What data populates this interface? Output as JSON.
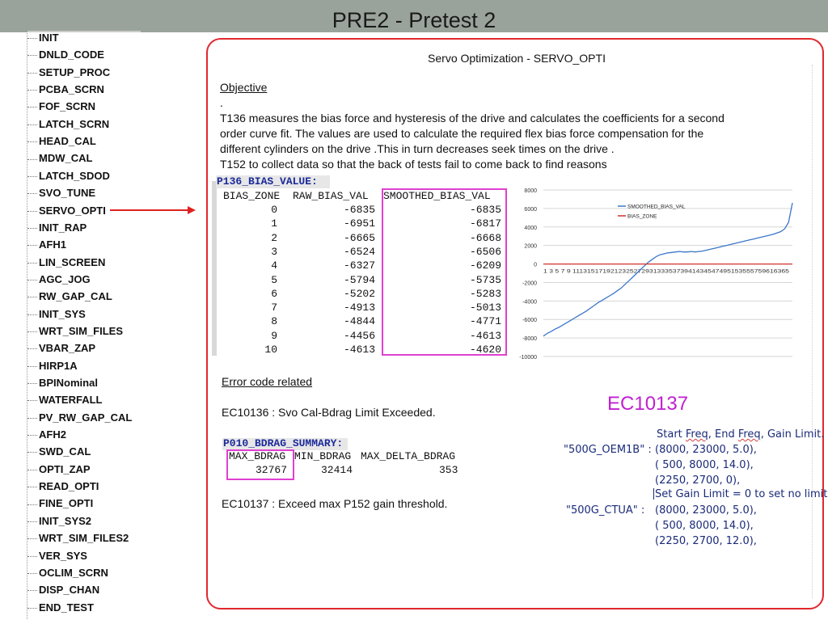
{
  "slide_title": "PRE2 - Pretest 2",
  "sidebar": {
    "items": [
      "INIT",
      "DNLD_CODE",
      "SETUP_PROC",
      "PCBA_SCRN",
      "FOF_SCRN",
      "LATCH_SCRN",
      "HEAD_CAL",
      "MDW_CAL",
      "LATCH_SDOD",
      "SVO_TUNE",
      "SERVO_OPTI",
      "INIT_RAP",
      "AFH1",
      "LIN_SCREEN",
      "AGC_JOG",
      "RW_GAP_CAL",
      "INIT_SYS",
      "WRT_SIM_FILES",
      "VBAR_ZAP",
      "HIRP1A",
      "BPINominal",
      "WATERFALL",
      "PV_RW_GAP_CAL",
      "AFH2",
      "SWD_CAL",
      "OPTI_ZAP",
      "READ_OPTI",
      "FINE_OPTI",
      "INIT_SYS2",
      "WRT_SIM_FILES2",
      "VER_SYS",
      "OCLIM_SCRN",
      "DISP_CHAN",
      "END_TEST"
    ],
    "highlighted": "SERVO_OPTI"
  },
  "panel": {
    "heading": "Servo Optimization - SERVO_OPTI",
    "objective_label": "Objective",
    "objective_dot": ".",
    "objective_lines": [
      "T136 measures the bias force and hysteresis of the drive and calculates the coefficients for a second",
      "order curve fit. The values are used to calculate the required flex bias force compensation for the",
      "different cylinders on the drive .This in turn decreases seek times on the drive .",
      "T152 to collect data so that the back of tests fail to come back to find reasons"
    ],
    "bias_table": {
      "title": "P136_BIAS_VALUE:",
      "headers": [
        "BIAS_ZONE",
        "RAW_BIAS_VAL",
        "SMOOTHED_BIAS_VAL"
      ],
      "rows": [
        [
          "0",
          "-6835",
          "-6835"
        ],
        [
          "1",
          "-6951",
          "-6817"
        ],
        [
          "2",
          "-6665",
          "-6668"
        ],
        [
          "3",
          "-6524",
          "-6506"
        ],
        [
          "4",
          "-6327",
          "-6209"
        ],
        [
          "5",
          "-5794",
          "-5735"
        ],
        [
          "6",
          "-5202",
          "-5283"
        ],
        [
          "7",
          "-4913",
          "-5013"
        ],
        [
          "8",
          "-4844",
          "-4771"
        ],
        [
          "9",
          "-4456",
          "-4613"
        ],
        [
          "10",
          "-4613",
          "-4620"
        ]
      ]
    },
    "error_label": "Error code related",
    "ec1": "EC10136 : Svo Cal-Bdrag Limit Exceeded.",
    "bdrag": {
      "title": "P010_BDRAG_SUMMARY:",
      "headers": [
        "MAX_BDRAG",
        "MIN_BDRAG",
        "MAX_DELTA_BDRAG"
      ],
      "values": [
        "32767",
        "32414",
        "353"
      ]
    },
    "ec2": "EC10137 : Exceed max P152 gain threshold.",
    "ec_big": "EC10137",
    "gain_note": {
      "header": "Start Freq, End Freq, Gain Limit.",
      "header_freq1": "Freq",
      "header_freq2": "Freq",
      "oem_label": "\"500G_OEM1B\"  :",
      "oem_rows": [
        "(8000,        23000,       5.0),",
        "( 500,          8000,        14.0),",
        "(2250,         2700,          0),"
      ],
      "set_gain": "Set Gain Limit = 0 to set no limit",
      "ctua_label": "\"500G_CTUA\"  :",
      "ctua_rows": [
        "(8000,        23000,       5.0),",
        "( 500,          8000,        14.0),",
        "(2250,         2700,        12.0),"
      ]
    }
  },
  "chart_data": {
    "type": "line",
    "title": "",
    "legend": [
      "SMOOTHED_BIAS_VAL",
      "BIAS_ZONE"
    ],
    "legend_position": "top-center",
    "ylim": [
      -10000,
      8000
    ],
    "yticks": [
      "8000",
      "6000",
      "4000",
      "2000",
      "0",
      "-2000",
      "-4000",
      "-6000",
      "-8000",
      "-10000"
    ],
    "xtick_text": "1 3 5 7 9 11131517192123252729313335373941434547495153555759616365",
    "x_count": 65,
    "series": [
      {
        "name": "SMOOTHED_BIAS_VAL",
        "color": "#3a77c8",
        "values": [
          -7800,
          -7500,
          -7300,
          -7050,
          -6850,
          -6600,
          -6350,
          -6100,
          -5850,
          -5600,
          -5350,
          -5100,
          -4800,
          -4500,
          -4200,
          -3950,
          -3700,
          -3450,
          -3200,
          -2900,
          -2600,
          -2200,
          -1800,
          -1400,
          -1000,
          -600,
          -200,
          200,
          500,
          800,
          1000,
          1100,
          1200,
          1250,
          1300,
          1350,
          1300,
          1300,
          1350,
          1300,
          1350,
          1400,
          1500,
          1600,
          1700,
          1800,
          1900,
          2000,
          2100,
          2200,
          2300,
          2400,
          2500,
          2600,
          2700,
          2800,
          2900,
          3000,
          3100,
          3200,
          3350,
          3500,
          3800,
          4500,
          6600
        ]
      },
      {
        "name": "BIAS_ZONE",
        "color": "#d0302e",
        "values": [
          0,
          0,
          0,
          0,
          0,
          0,
          0,
          0,
          0,
          0,
          0,
          0,
          0,
          0,
          0,
          0,
          0,
          0,
          0,
          0,
          0,
          0,
          0,
          0,
          0,
          0,
          0,
          0,
          0,
          0,
          0,
          0,
          0,
          0,
          0,
          0,
          0,
          0,
          0,
          0,
          0,
          0,
          0,
          0,
          0,
          0,
          0,
          0,
          0,
          0,
          0,
          0,
          0,
          0,
          0,
          0,
          0,
          0,
          0,
          0,
          0,
          0,
          0,
          0,
          0
        ]
      }
    ],
    "grid": true
  }
}
